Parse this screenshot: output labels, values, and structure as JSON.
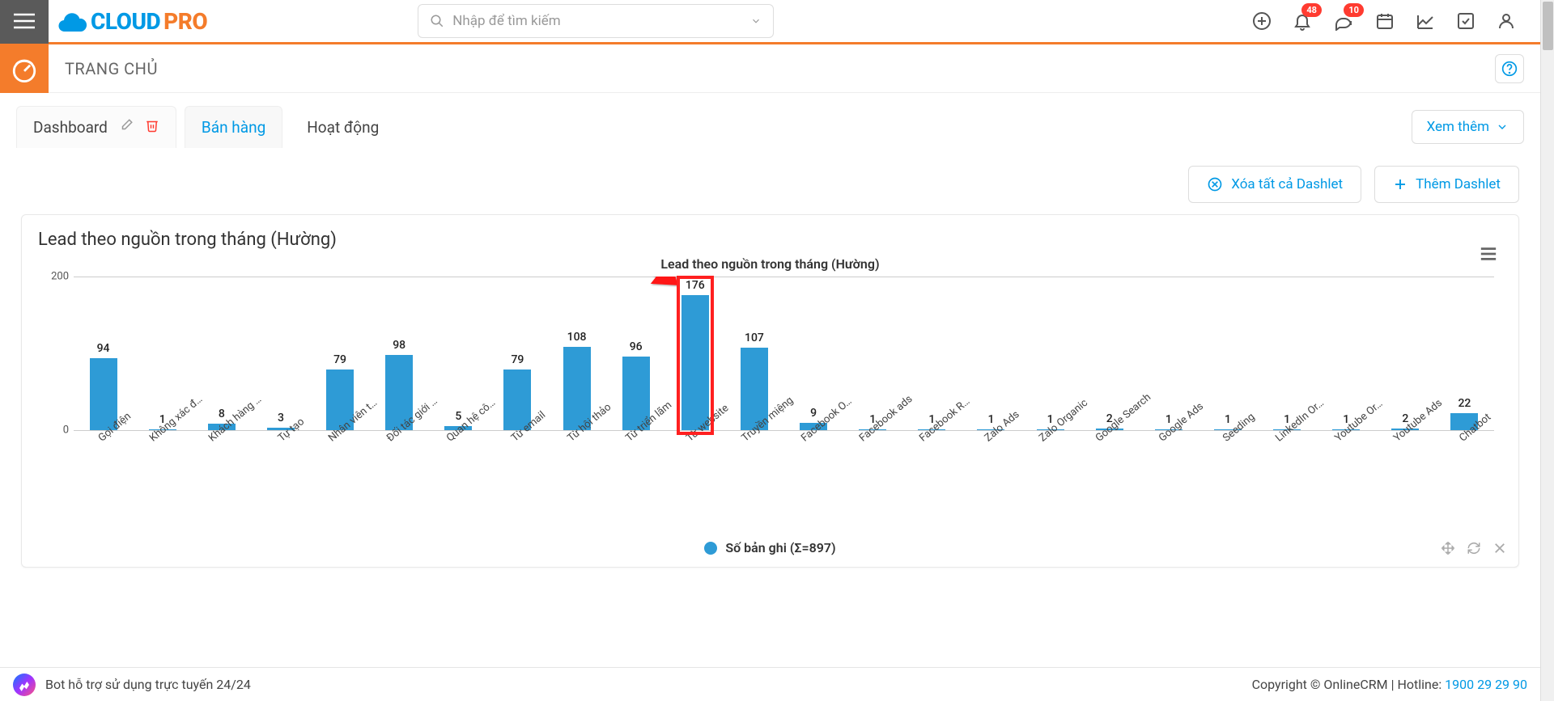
{
  "logo": {
    "cloud": "CLOUD",
    "pro": "PRO"
  },
  "search": {
    "placeholder": "Nhập để tìm kiếm"
  },
  "badges": {
    "bell": "48",
    "chat": "10"
  },
  "page": {
    "title": "TRANG CHỦ"
  },
  "tabs": {
    "dashboard": "Dashboard",
    "banhang": "Bán hàng",
    "hoatdong": "Hoạt động"
  },
  "buttons": {
    "xemthem": "Xem thêm",
    "clear": "Xóa tất cả Dashlet",
    "add": "Thêm Dashlet"
  },
  "card": {
    "title": "Lead theo nguồn trong tháng (Hường)"
  },
  "chart_data": {
    "type": "bar",
    "title": "Lead theo nguồn trong tháng (Hường)",
    "ylabel": "",
    "xlabel": "",
    "ylim": [
      0,
      200
    ],
    "yticks": [
      0,
      200
    ],
    "legend": "Số bản ghi (Σ=897)",
    "categories": [
      "Gọi điện",
      "Không xác đ…",
      "Khách hàng …",
      "Tự tạo",
      "Nhân viên t…",
      "Đối tác giới …",
      "Quan hệ cô…",
      "Từ email",
      "Từ hội thảo",
      "Từ triển lãm",
      "Từ website",
      "Truyền miệng",
      "Facebook O…",
      "Facebook ads",
      "Facebook R…",
      "Zalo Ads",
      "Zalo Organic",
      "Google Search",
      "Google Ads",
      "Seeding",
      "LinkedIn Or…",
      "Youtube Or…",
      "Youtube Ads",
      "Chatbot"
    ],
    "values": [
      94,
      1,
      8,
      3,
      79,
      98,
      5,
      79,
      108,
      96,
      176,
      107,
      9,
      1,
      1,
      1,
      1,
      2,
      1,
      1,
      1,
      1,
      2,
      22
    ],
    "highlight_index": 10
  },
  "footer": {
    "bot": "Bot hỗ trợ sử dụng trực tuyến 24/24",
    "copyright": "Copyright © OnlineCRM",
    "hotline_label": "Hotline: ",
    "hotline": "1900 29 29 90"
  }
}
